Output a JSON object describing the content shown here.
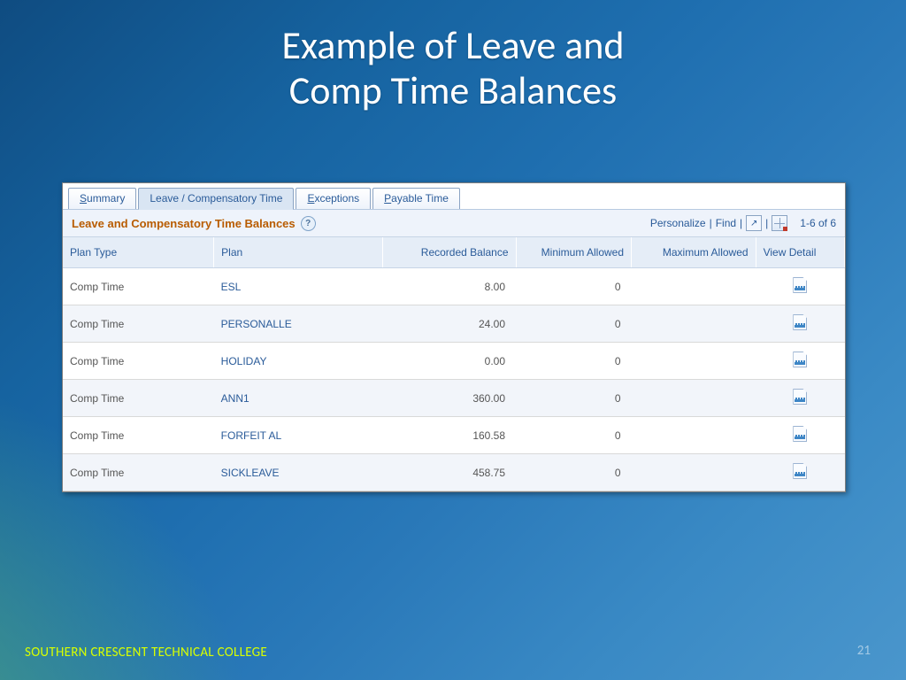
{
  "slide": {
    "title_line1": "Example of Leave and",
    "title_line2": "Comp Time Balances",
    "footer_org": "SOUTHERN CRESCENT TECHNICAL COLLEGE",
    "page_number": "21"
  },
  "tabs": [
    {
      "label_pre": "",
      "label_u": "S",
      "label_post": "ummary",
      "active": false
    },
    {
      "label_pre": "Leave / Compensatory Time",
      "label_u": "",
      "label_post": "",
      "active": true
    },
    {
      "label_pre": "",
      "label_u": "E",
      "label_post": "xceptions",
      "active": false
    },
    {
      "label_pre": "",
      "label_u": "P",
      "label_post": "ayable Time",
      "active": false
    }
  ],
  "toolbar": {
    "section_title": "Leave and Compensatory Time Balances",
    "personalize": "Personalize",
    "find": "Find",
    "range": "1-6 of 6"
  },
  "columns": {
    "plan_type": "Plan Type",
    "plan": "Plan",
    "recorded": "Recorded Balance",
    "min": "Minimum Allowed",
    "max": "Maximum Allowed",
    "detail": "View Detail"
  },
  "rows": [
    {
      "plan_type": "Comp Time",
      "plan": "ESL",
      "recorded": "8.00",
      "min": "0",
      "max": ""
    },
    {
      "plan_type": "Comp Time",
      "plan": "PERSONALLE",
      "recorded": "24.00",
      "min": "0",
      "max": ""
    },
    {
      "plan_type": "Comp Time",
      "plan": "HOLIDAY",
      "recorded": "0.00",
      "min": "0",
      "max": ""
    },
    {
      "plan_type": "Comp Time",
      "plan": "ANN1",
      "recorded": "360.00",
      "min": "0",
      "max": ""
    },
    {
      "plan_type": "Comp Time",
      "plan": "FORFEIT AL",
      "recorded": "160.58",
      "min": "0",
      "max": ""
    },
    {
      "plan_type": "Comp Time",
      "plan": "SICKLEAVE",
      "recorded": "458.75",
      "min": "0",
      "max": ""
    }
  ]
}
